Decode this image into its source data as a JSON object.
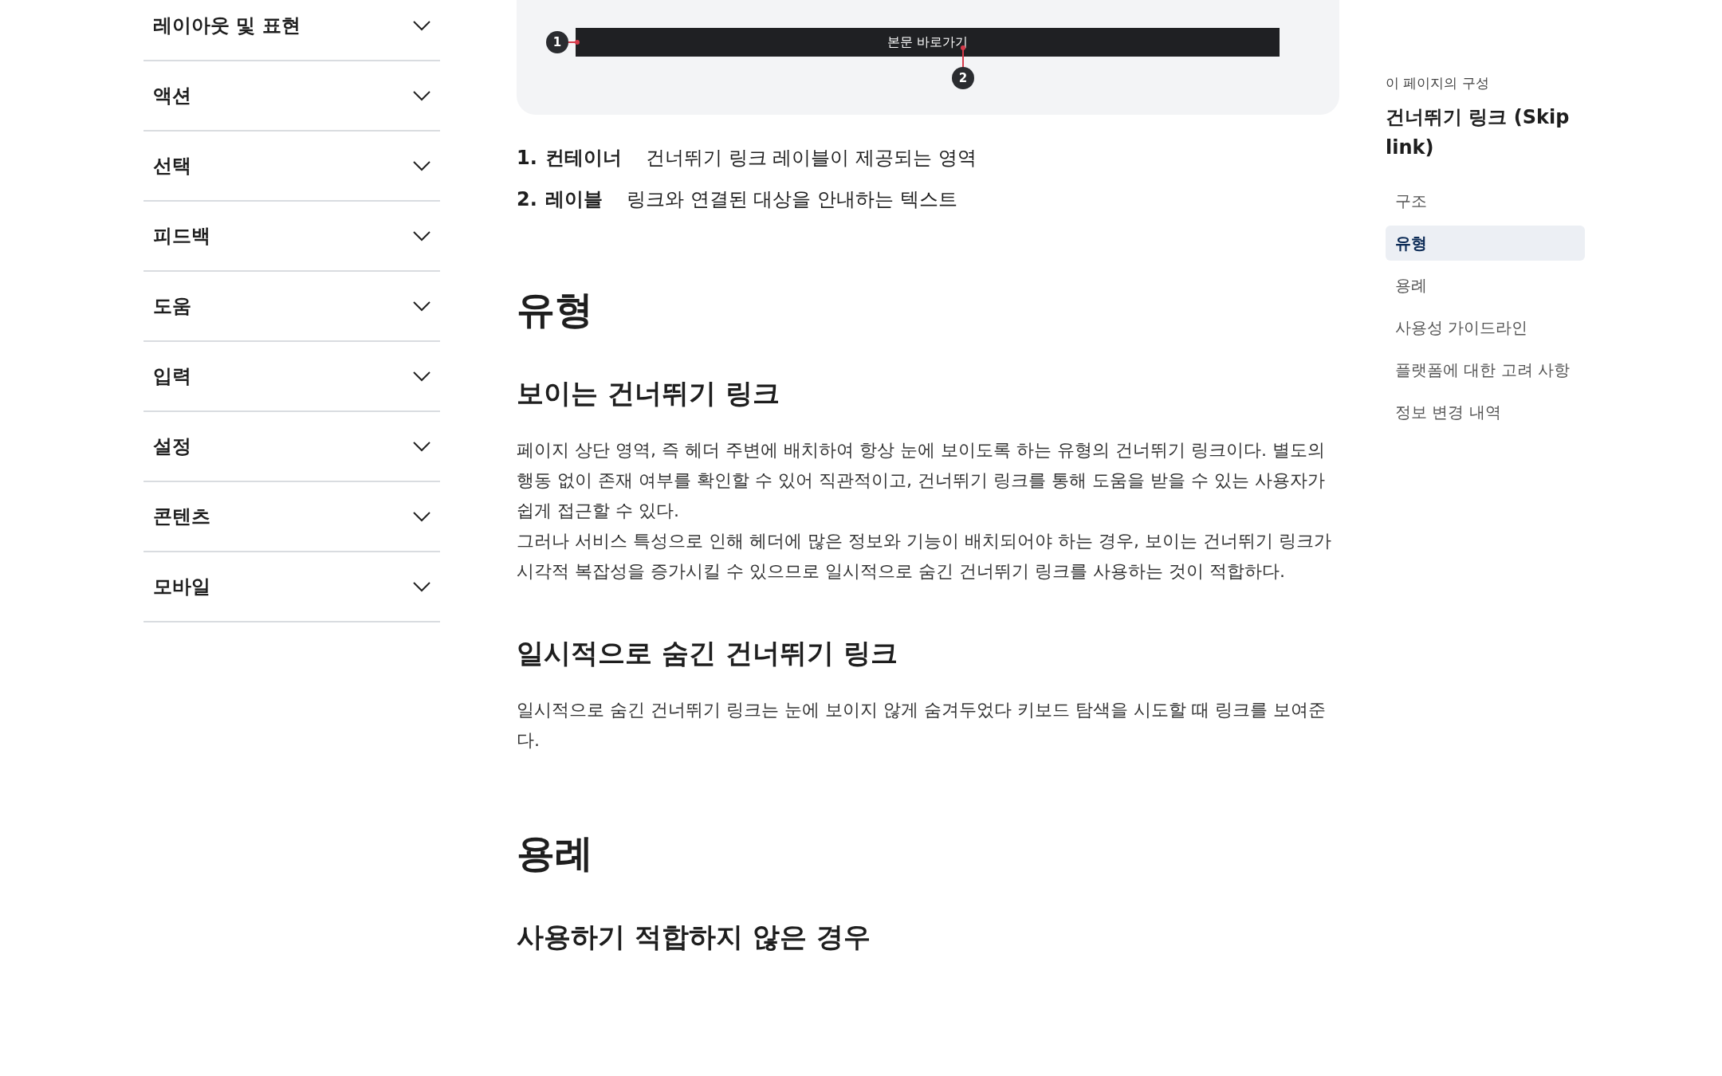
{
  "sidebar": {
    "items": [
      {
        "label": "레이아웃 및 표현",
        "expanded": false
      },
      {
        "label": "액션",
        "expanded": false
      },
      {
        "label": "선택",
        "expanded": false
      },
      {
        "label": "피드백",
        "expanded": false
      },
      {
        "label": "도움",
        "expanded": false
      },
      {
        "label": "입력",
        "expanded": false
      },
      {
        "label": "설정",
        "expanded": false
      },
      {
        "label": "콘텐츠",
        "expanded": false
      },
      {
        "label": "모바일",
        "expanded": false
      }
    ]
  },
  "diagram": {
    "bar_label": "본문 바로가기",
    "markers": [
      "1",
      "2"
    ]
  },
  "anatomy": [
    {
      "number": "1.",
      "term": "컨테이너",
      "description": "건너뛰기 링크 레이블이 제공되는 영역"
    },
    {
      "number": "2.",
      "term": "레이블",
      "description": "링크와 연결된 대상을 안내하는 텍스트"
    }
  ],
  "sections": [
    {
      "kind": "h2",
      "text": "유형"
    },
    {
      "kind": "h3",
      "text": "보이는 건너뛰기 링크"
    },
    {
      "kind": "p",
      "text": "페이지 상단 영역, 즉 헤더 주변에 배치하여 항상 눈에 보이도록 하는 유형의 건너뛰기 링크이다. 별도의 행동 없이 존재 여부를 확인할 수 있어 직관적이고, 건너뛰기 링크를 통해 도움을 받을 수 있는 사용자가 쉽게 접근할 수 있다."
    },
    {
      "kind": "p",
      "text": "그러나 서비스 특성으로 인해 헤더에 많은 정보와 기능이 배치되어야 하는 경우, 보이는 건너뛰기 링크가 시각적 복잡성을 증가시킬 수 있으므로 일시적으로 숨긴 건너뛰기 링크를 사용하는 것이 적합하다."
    },
    {
      "kind": "h3",
      "text": "일시적으로 숨긴 건너뛰기 링크"
    },
    {
      "kind": "p",
      "text": "일시적으로 숨긴 건너뛰기 링크는 눈에 보이지 않게 숨겨두었다 키보드 탐색을 시도할 때 링크를 보여준다."
    },
    {
      "kind": "h2",
      "text": "용례"
    },
    {
      "kind": "h3",
      "text": "사용하기 적합하지 않은 경우"
    }
  ],
  "toc": {
    "caption": "이 페이지의 구성",
    "title": "건너뛰기 링크 (Skip link)",
    "items": [
      {
        "label": "구조",
        "selected": false
      },
      {
        "label": "유형",
        "selected": true
      },
      {
        "label": "용례",
        "selected": false
      },
      {
        "label": "사용성 가이드라인",
        "selected": false
      },
      {
        "label": "플랫폼에 대한 고려 사항",
        "selected": false
      },
      {
        "label": "정보 변경 내역",
        "selected": false
      }
    ]
  }
}
